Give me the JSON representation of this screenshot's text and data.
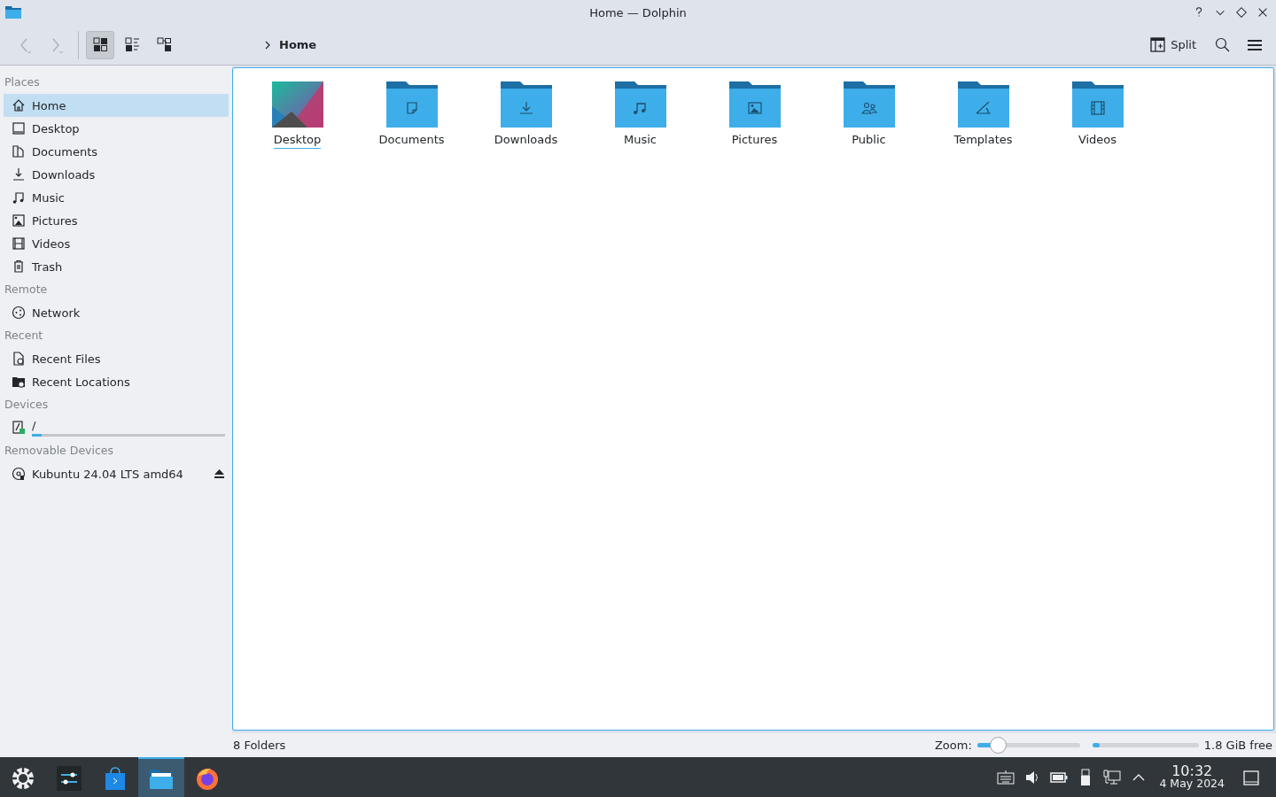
{
  "window": {
    "title": "Home — Dolphin"
  },
  "toolbar": {
    "view_modes": [
      {
        "kind": "icons",
        "selected": true
      },
      {
        "kind": "compact",
        "selected": false
      },
      {
        "kind": "details",
        "selected": false
      }
    ],
    "breadcrumb": "Home",
    "split_label": "Split"
  },
  "sidebar": {
    "sections": [
      {
        "title": "Places",
        "items": [
          {
            "label": "Home",
            "selected": true
          },
          {
            "label": "Desktop",
            "selected": false
          },
          {
            "label": "Documents",
            "selected": false
          },
          {
            "label": "Downloads",
            "selected": false
          },
          {
            "label": "Music",
            "selected": false
          },
          {
            "label": "Pictures",
            "selected": false
          },
          {
            "label": "Videos",
            "selected": false
          },
          {
            "label": "Trash",
            "selected": false
          }
        ]
      },
      {
        "title": "Remote",
        "items": [
          {
            "label": "Network",
            "selected": false
          }
        ]
      },
      {
        "title": "Recent",
        "items": [
          {
            "label": "Recent Files",
            "selected": false
          },
          {
            "label": "Recent Locations",
            "selected": false
          }
        ]
      },
      {
        "title": "Devices",
        "items": [
          {
            "label": "/",
            "selected": false,
            "level": 0.05
          }
        ]
      },
      {
        "title": "Removable Devices",
        "items": [
          {
            "label": "Kubuntu 24.04 LTS amd64",
            "selected": false,
            "eject": true
          }
        ]
      }
    ]
  },
  "files": [
    {
      "name": "Desktop",
      "kind": "wallpaper",
      "focused": true
    },
    {
      "name": "Documents",
      "kind": "documents",
      "focused": false
    },
    {
      "name": "Downloads",
      "kind": "downloads",
      "focused": false
    },
    {
      "name": "Music",
      "kind": "music",
      "focused": false
    },
    {
      "name": "Pictures",
      "kind": "pictures",
      "focused": false
    },
    {
      "name": "Public",
      "kind": "public",
      "focused": false
    },
    {
      "name": "Templates",
      "kind": "templates",
      "focused": false
    },
    {
      "name": "Videos",
      "kind": "videos",
      "focused": false
    }
  ],
  "status_bar": {
    "summary": "8 Folders",
    "zoom_label": "Zoom:",
    "zoom": {
      "level": 0.2
    },
    "space": {
      "level": 0.03
    },
    "free": "1.8 GiB free"
  },
  "taskbar": {
    "apps": [
      {
        "kind": "launcher",
        "active": false
      },
      {
        "kind": "settings",
        "active": false
      },
      {
        "kind": "store",
        "active": false
      },
      {
        "kind": "files",
        "active": true
      },
      {
        "kind": "browser",
        "active": false
      }
    ],
    "clock": {
      "time": "10:32",
      "date": "4 May 2024"
    }
  }
}
